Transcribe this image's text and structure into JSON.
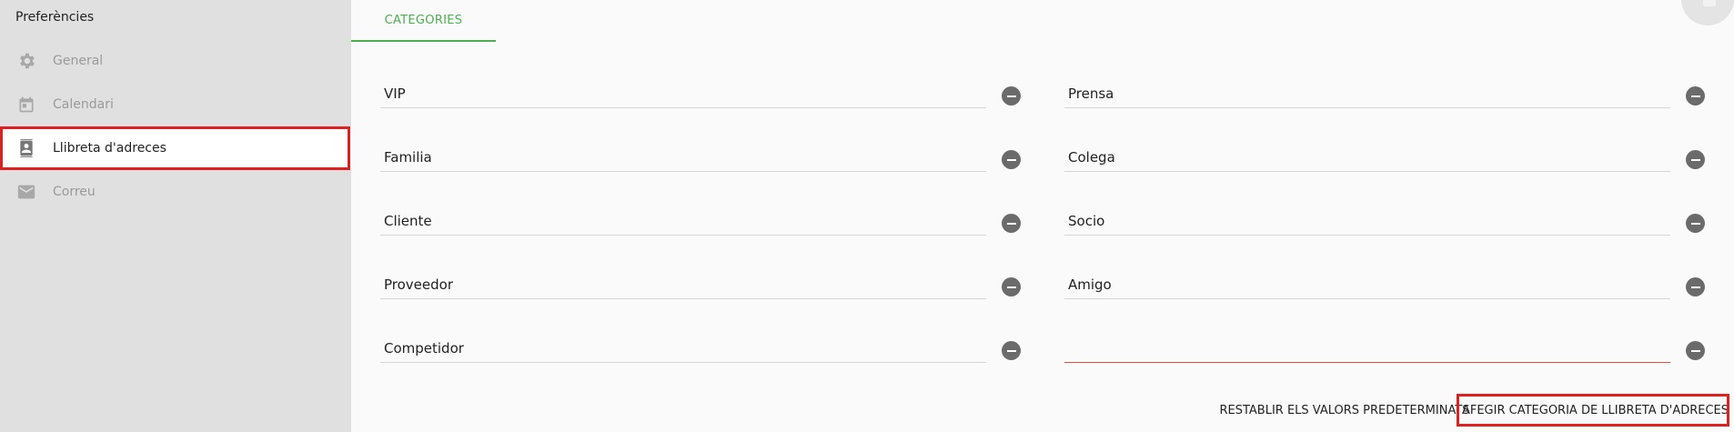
{
  "sidebar": {
    "title": "Preferències",
    "items": [
      {
        "label": "General",
        "icon": "gear-icon"
      },
      {
        "label": "Calendari",
        "icon": "calendar-icon"
      },
      {
        "label": "Llibreta d'adreces",
        "icon": "contacts-icon"
      },
      {
        "label": "Correu",
        "icon": "mail-icon"
      }
    ]
  },
  "main": {
    "tab": "CATEGORIES",
    "categories_left": [
      "VIP",
      "Familia",
      "Cliente",
      "Proveedor",
      "Competidor"
    ],
    "categories_right": [
      "Prensa",
      "Colega",
      "Socio",
      "Amigo",
      ""
    ],
    "reset_label": "RESTABLIR ELS VALORS PREDETERMINATS",
    "add_label": "AFEGIR CATEGORIA DE LLIBRETA D'ADRECES"
  },
  "colors": {
    "accent": "#4caf50",
    "highlight": "#e02020",
    "error_underline": "#e0533a"
  }
}
